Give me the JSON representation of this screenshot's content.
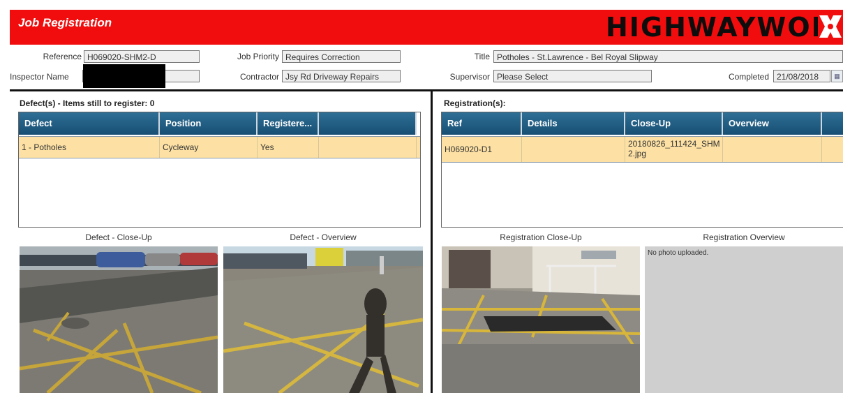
{
  "header": {
    "title": "Job Registration",
    "brand": "HIGHWAYWOR"
  },
  "form": {
    "reference": {
      "label": "Reference",
      "value": "H069020-SHM2-D"
    },
    "job_priority": {
      "label": "Job Priority",
      "value": "Requires Correction"
    },
    "title": {
      "label": "Title",
      "value": "Potholes - St.Lawrence - Bel Royal Slipway"
    },
    "inspector_name": {
      "label": "Inspector Name",
      "value": ""
    },
    "contractor": {
      "label": "Contractor",
      "value": "Jsy Rd Driveway Repairs"
    },
    "supervisor": {
      "label": "Supervisor",
      "value": "Please Select"
    },
    "completed": {
      "label": "Completed",
      "value": "21/08/2018"
    }
  },
  "defects": {
    "heading": "Defect(s) - Items still to register: 0",
    "columns": [
      "Defect",
      "Position",
      "Registere..."
    ],
    "rows": [
      {
        "defect": "1 - Potholes",
        "position": "Cycleway",
        "registered": "Yes"
      }
    ]
  },
  "registrations": {
    "heading": "Registration(s):",
    "columns": [
      "Ref",
      "Details",
      "Close-Up",
      "Overview"
    ],
    "rows": [
      {
        "ref": "H069020-D1",
        "details": "",
        "close_up": "20180826_111424_SHM2.jpg",
        "overview": ""
      }
    ]
  },
  "photos": {
    "defect_closeup": "Defect - Close-Up",
    "defect_overview": "Defect - Overview",
    "reg_closeup": "Registration Close-Up",
    "reg_overview": "Registration Overview",
    "no_photo": "No photo uploaded."
  },
  "colors": {
    "header_red": "#f10d0d",
    "grid_header": "#1f5f86",
    "row_highlight": "#fde1a4"
  }
}
